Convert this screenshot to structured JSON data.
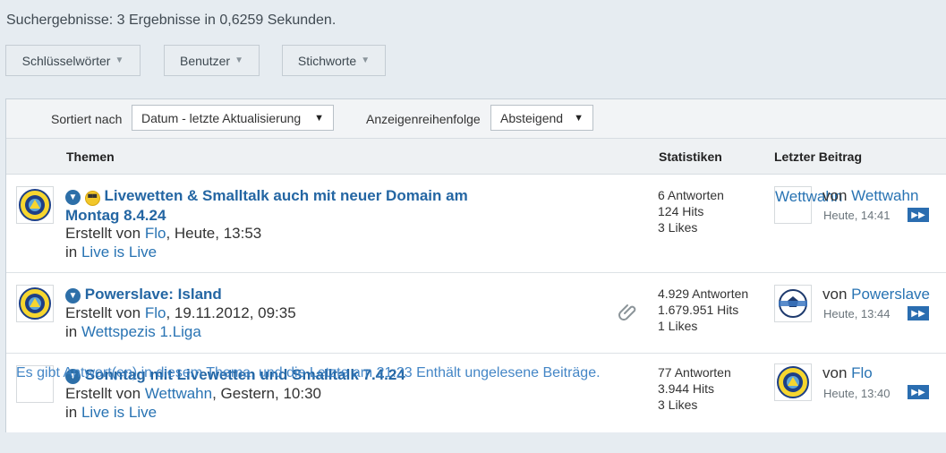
{
  "header": {
    "results_text": "Suchergebnisse: 3 Ergebnisse in 0,6259 Sekunden."
  },
  "filters": [
    {
      "label": "Schlüsselwörter"
    },
    {
      "label": "Benutzer"
    },
    {
      "label": "Stichworte"
    }
  ],
  "sortbar": {
    "sort_label": "Sortiert nach",
    "sort_value": "Datum - letzte Aktualisierung",
    "order_label": "Anzeigenreihenfolge",
    "order_value": "Absteigend"
  },
  "columns": {
    "topics": "Themen",
    "stats": "Statistiken",
    "last_post": "Letzter Beitrag"
  },
  "rows": [
    {
      "title_line1": "Livewetten & Smalltalk auch mit neuer Domain am",
      "title_line2": "Montag 8.4.24",
      "created_prefix": "Erstellt von ",
      "author": "Flo",
      "created_suffix": ", Heute, 13:53",
      "in_prefix": "in ",
      "forum": "Live is Live",
      "replies": "6 Antworten",
      "hits": "124 Hits",
      "likes": "3 Likes",
      "last_thumb_text": "Wettwahn",
      "last_by_prefix": "von ",
      "last_by": "Wettwahn",
      "last_time": "Heute, 14:41"
    },
    {
      "title_line1": "Powerslave: Island",
      "created_prefix": "Erstellt von ",
      "author": "Flo",
      "created_suffix": ", 19.11.2012, 09:35",
      "in_prefix": "in ",
      "forum": "Wettspezis 1.Liga",
      "replies": "4.929 Antworten",
      "hits": "1.679.951 Hits",
      "likes": "1 Likes",
      "last_by_prefix": "von ",
      "last_by": "Powerslave",
      "last_time": "Heute, 13:44"
    },
    {
      "title_line1": "Sonntag mit Livewetten und Smalltalk 7.4.24",
      "created_prefix": "Erstellt von ",
      "author": "Wettwahn",
      "created_suffix": ", Gestern, 10:30",
      "in_prefix": "in ",
      "forum": "Live is Live",
      "replies": "77 Antworten",
      "hits": "3.944 Hits",
      "likes": "3 Likes",
      "last_by_prefix": "von ",
      "last_by": "Flo",
      "last_time": "Heute, 13:40"
    }
  ],
  "overlay_text": "Es gibt Antwort(en) in diesem Thema, und die Letzte am 21:23 Enthält ungelesene Beiträge.",
  "colors": {
    "link": "#2466a3",
    "accent": "#2a6db0",
    "background": "#e6ecf1"
  }
}
